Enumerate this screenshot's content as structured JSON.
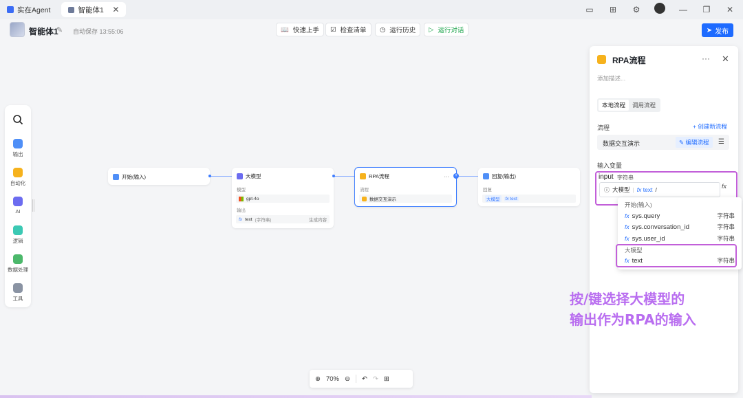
{
  "tabs": [
    {
      "label": "实在Agent",
      "active": false
    },
    {
      "label": "智能体1",
      "active": true
    }
  ],
  "window_icons": [
    "monitor-icon",
    "gift-icon",
    "gear-icon",
    "user-avatar",
    "minimize-icon",
    "restore-icon",
    "close-icon"
  ],
  "header": {
    "agent_name": "智能体1",
    "autosave": "自动保存 13:55:06",
    "buttons": [
      "快速上手",
      "检查清单",
      "运行历史",
      "运行对话"
    ],
    "publish": "发布"
  },
  "left_toolbar": [
    "输出",
    "自动化",
    "AI",
    "逻辑",
    "数据处理",
    "工具"
  ],
  "nodes": {
    "start": {
      "title": "开始(输入)"
    },
    "llm": {
      "title": "大模型",
      "model_label": "模型",
      "model": "gpt-4o",
      "output_label": "输出",
      "output_name": "text",
      "output_type": "(字符串)",
      "output_desc": "生成内容"
    },
    "rpa": {
      "title": "RPA流程",
      "flow_label": "流程",
      "flow": "数据交互演示"
    },
    "reply": {
      "title": "回复(输出)",
      "reply_label": "回复",
      "tag1": "大模型",
      "tag2": "text"
    }
  },
  "panel": {
    "title": "RPA流程",
    "description_placeholder": "添加描述...",
    "segments": [
      "本地流程",
      "调用流程"
    ],
    "flow_label": "流程",
    "new_flow": "+ 创建新流程",
    "flow_name": "数据交互演示",
    "edit_flow": "编辑流程",
    "input_vars_label": "输入变量",
    "input_name": "input",
    "input_type": "字符串",
    "input_value_tag1": "大模型",
    "input_value_tag2": "text",
    "input_cursor": "/",
    "fx_label": "fx"
  },
  "dropdown": {
    "group1": "开始(输入)",
    "items1": [
      {
        "name": "sys.query",
        "type": "字符串"
      },
      {
        "name": "sys.conversation_id",
        "type": "字符串"
      },
      {
        "name": "sys.user_id",
        "type": "字符串"
      }
    ],
    "group2": "大模型",
    "items2": [
      {
        "name": "text",
        "type": "字符串"
      }
    ]
  },
  "annotation": {
    "line1": "按/键选择大模型的",
    "line2": "输出作为RPA的输入"
  },
  "zoom": {
    "level": "70%"
  },
  "colors": {
    "accent": "#1e6bff",
    "highlight": "#c25fd9",
    "annotation": "#b96ef0",
    "run": "#1aa34a"
  }
}
